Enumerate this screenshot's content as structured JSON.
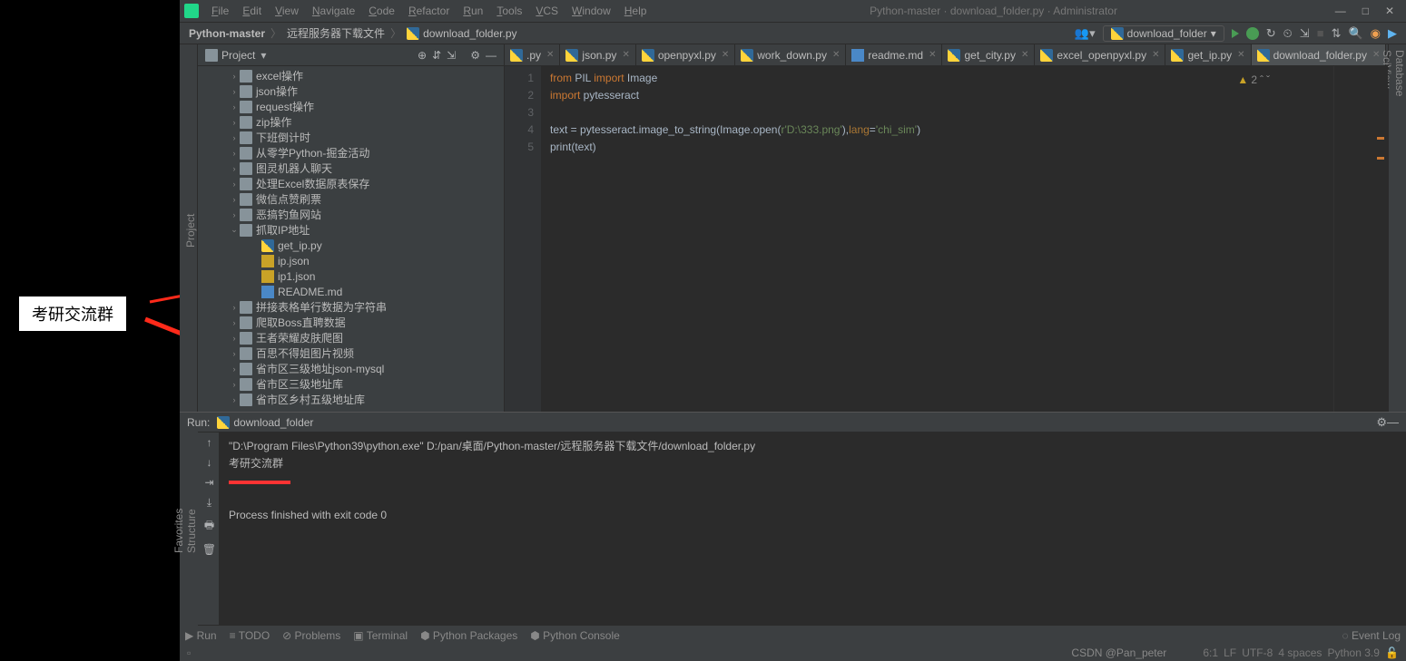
{
  "window_title": "Python-master · download_folder.py · Administrator",
  "menu": [
    "File",
    "Edit",
    "View",
    "Navigate",
    "Code",
    "Refactor",
    "Run",
    "Tools",
    "VCS",
    "Window",
    "Help"
  ],
  "breadcrumb": [
    "Python-master",
    "远程服务器下载文件",
    "download_folder.py"
  ],
  "run_config": "download_folder",
  "project_panel": {
    "title": "Project"
  },
  "tree": [
    {
      "indent": 2,
      "arrow": "›",
      "icon": "folder",
      "label": "excel操作"
    },
    {
      "indent": 2,
      "arrow": "›",
      "icon": "folder",
      "label": "json操作"
    },
    {
      "indent": 2,
      "arrow": "›",
      "icon": "folder",
      "label": "request操作"
    },
    {
      "indent": 2,
      "arrow": "›",
      "icon": "folder",
      "label": "zip操作"
    },
    {
      "indent": 2,
      "arrow": "›",
      "icon": "folder",
      "label": "下班倒计时"
    },
    {
      "indent": 2,
      "arrow": "›",
      "icon": "folder",
      "label": "从零学Python-掘金活动"
    },
    {
      "indent": 2,
      "arrow": "›",
      "icon": "folder",
      "label": "图灵机器人聊天"
    },
    {
      "indent": 2,
      "arrow": "›",
      "icon": "folder",
      "label": "处理Excel数据原表保存"
    },
    {
      "indent": 2,
      "arrow": "›",
      "icon": "folder",
      "label": "微信点赞刷票"
    },
    {
      "indent": 2,
      "arrow": "›",
      "icon": "folder",
      "label": "恶搞钓鱼网站"
    },
    {
      "indent": 2,
      "arrow": "⌄",
      "icon": "folder",
      "label": "抓取IP地址"
    },
    {
      "indent": 4,
      "arrow": "",
      "icon": "py",
      "label": "get_ip.py"
    },
    {
      "indent": 4,
      "arrow": "",
      "icon": "json",
      "label": "ip.json"
    },
    {
      "indent": 4,
      "arrow": "",
      "icon": "json",
      "label": "ip1.json"
    },
    {
      "indent": 4,
      "arrow": "",
      "icon": "md",
      "label": "README.md"
    },
    {
      "indent": 2,
      "arrow": "›",
      "icon": "folder",
      "label": "拼接表格单行数据为字符串"
    },
    {
      "indent": 2,
      "arrow": "›",
      "icon": "folder",
      "label": "爬取Boss直聘数据"
    },
    {
      "indent": 2,
      "arrow": "›",
      "icon": "folder",
      "label": "王者荣耀皮肤爬图"
    },
    {
      "indent": 2,
      "arrow": "›",
      "icon": "folder",
      "label": "百思不得姐图片视频"
    },
    {
      "indent": 2,
      "arrow": "›",
      "icon": "folder",
      "label": "省市区三级地址json-mysql"
    },
    {
      "indent": 2,
      "arrow": "›",
      "icon": "folder",
      "label": "省市区三级地址库"
    },
    {
      "indent": 2,
      "arrow": "›",
      "icon": "folder",
      "label": "省市区乡村五级地址库"
    }
  ],
  "tabs": [
    {
      "label": ".py",
      "active": false
    },
    {
      "label": "json.py",
      "active": false
    },
    {
      "label": "openpyxl.py",
      "active": false
    },
    {
      "label": "work_down.py",
      "active": false
    },
    {
      "label": "readme.md",
      "active": false,
      "icon": "md"
    },
    {
      "label": "get_city.py",
      "active": false
    },
    {
      "label": "excel_openpyxl.py",
      "active": false
    },
    {
      "label": "get_ip.py",
      "active": false
    },
    {
      "label": "download_folder.py",
      "active": true
    }
  ],
  "gutter": [
    "1",
    "2",
    "3",
    "4",
    "5"
  ],
  "code": {
    "l1a": "from",
    "l1b": " PIL ",
    "l1c": "import",
    "l1d": " Image",
    "l2a": "import",
    "l2b": " pytesseract",
    "l4a": "text = pytesseract.image_to_string(Image.open(",
    "l4b": "r'D:\\333.png'",
    "l4c": "),",
    "l4d": "lang",
    "l4e": "=",
    "l4f": "'chi_sim'",
    "l4g": ")",
    "l5a": "print",
    "l5b": "(text)"
  },
  "warning_count": "2",
  "run_panel": {
    "title": "Run:",
    "config": "download_folder",
    "line1": "\"D:\\Program Files\\Python39\\python.exe\" D:/pan/桌面/Python-master/远程服务器下载文件/download_folder.py",
    "line2": "考研交流群",
    "line3": "",
    "line4": "Process finished with exit code 0"
  },
  "bottom_bar": {
    "run": "Run",
    "todo": "TODO",
    "problems": "Problems",
    "terminal": "Terminal",
    "pkg": "Python Packages",
    "console": "Python Console",
    "eventlog": "Event Log"
  },
  "status": {
    "pos": "6:1",
    "le": "LF",
    "enc": "UTF-8",
    "indent": "4 spaces",
    "interp": "Python 3.9"
  },
  "watermark": "CSDN @Pan_peter",
  "left_tabs": {
    "project": "Project",
    "structure": "Structure",
    "favorites": "Favorites"
  },
  "right_tabs": {
    "database": "Database",
    "sciview": "SciView"
  },
  "annotation": "考研交流群"
}
